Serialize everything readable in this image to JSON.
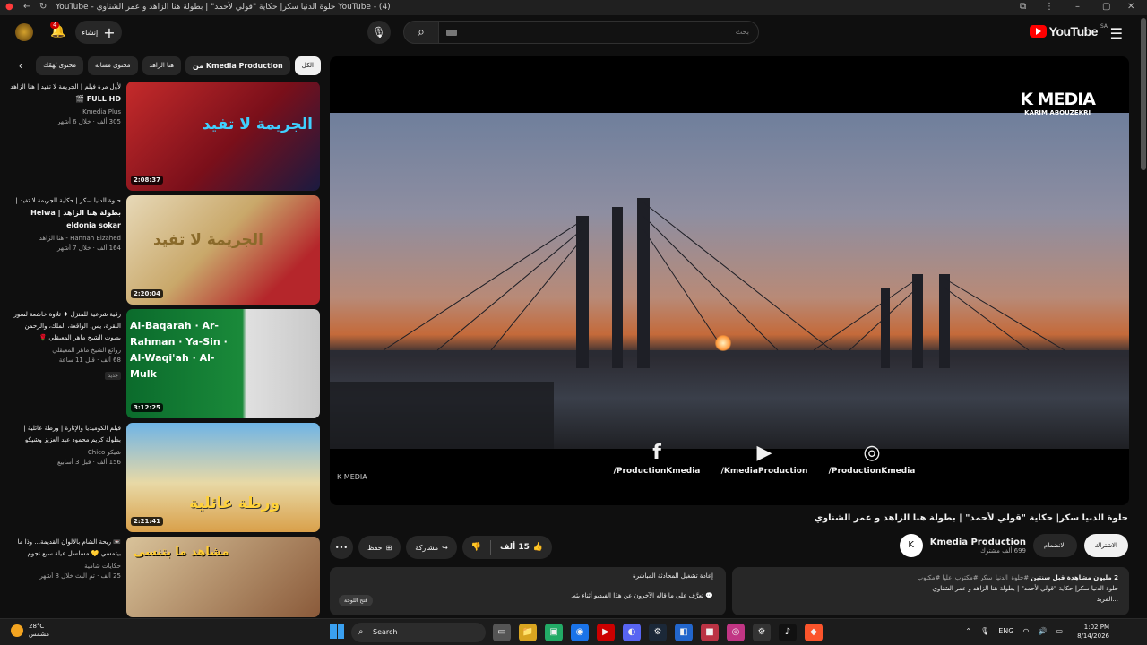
{
  "window": {
    "title": "YouTube - (4) حلوة الدنيا سكر| حكاية \"قولي لأحمد\" | بطولة هنا الزاهد و عمر الشناوي - YouTube"
  },
  "header": {
    "logo_text": "YouTube",
    "region": "SA",
    "search_placeholder": "بحث",
    "create_label": "إنشاء",
    "notifications_count": "4"
  },
  "chips": [
    {
      "label": "الكل",
      "active": true
    },
    {
      "label": "من Kmedia Production",
      "active": false,
      "bold": true
    },
    {
      "label": "هنا الزاهد",
      "active": false
    },
    {
      "label": "محتوى مشابه",
      "active": false
    },
    {
      "label": "محتوى يُهمّك",
      "active": false
    }
  ],
  "recommendations": [
    {
      "title": "لأول مرة فيلم | الجريمة لا تفيد | هنا الزاهد",
      "title2": "FULL HD 🎬",
      "channel": "Kmedia Plus",
      "stats": "305 ألف · خلال 6 أشهر",
      "duration": "2:08:37",
      "thumb_text": "الجريمة لا تفيد",
      "new": ""
    },
    {
      "title": "حلوة الدنيا سكر | حكاية الجريمة لا تفيد |",
      "title2": "بطولة هنا الزاهد | Helwa eldonia sokar",
      "channel": "Hannah Elzahed - هنا الزاهد",
      "stats": "164 ألف · خلال 7 أشهر",
      "duration": "2:20:04",
      "thumb_text": "الجريمة لا تفيد",
      "new": ""
    },
    {
      "title": "رقية شرعية للمنزل ♦ تلاوة خاشعة لسور البقرة، يس، الواقعة، الملك، والرحمن",
      "title2": "بصوت الشيخ ماهر المعيقلي 🌹",
      "channel": "روائع الشيخ ماهر المعيقلي",
      "stats": "68 ألف · قبل 11 ساعة",
      "duration": "3:12:25",
      "thumb_text": "Al-Baqarah · Ar-Rahman · Ya-Sin · Al-Waqi'ah · Al-Mulk",
      "new": "جديد"
    },
    {
      "title": "فيلم الكوميديا والإثارة | ورطة عائلية |",
      "title2": "بطولة كريم محمود عبد العزيز وشيكو",
      "channel": "شيكو Chico",
      "stats": "156 ألف · قبل 3 أسابيع",
      "duration": "2:21:41",
      "thumb_text": "ورطة عائلية",
      "new": ""
    },
    {
      "title": "📼 ريحة الشام بالألوان القديمة... وذا ما",
      "title2": "بيتمسي 💛 مسلسل عيلة سبع نجوم",
      "channel": "حكايات شامية",
      "stats": "25 ألف · تم البث خلال 8 أشهر",
      "duration": "",
      "thumb_text": "مشاهد ما بتنسى",
      "new": ""
    }
  ],
  "player": {
    "brand_big": "K MEDIA",
    "brand_small": "KARIM ABOUZEKRI",
    "socials": [
      {
        "icon": "f",
        "label": "/ProductionKmedia"
      },
      {
        "icon": "▶",
        "label": "/KmediaProduction"
      },
      {
        "icon": "◎",
        "label": "/ProductionKmedia"
      }
    ],
    "mini_logo": "K MEDIA"
  },
  "video": {
    "title": "حلوة الدنيا سكر| حكاية \"قولي لأحمد\" | بطولة هنا الزاهد و عمر الشناوي",
    "channel": "Kmedia Production",
    "subscribers": "699 ألف مشترك",
    "subscribe_label": "الاشتراك",
    "join_label": "الانضمام",
    "likes": "15 ألف",
    "share_label": "مشاركة",
    "save_label": "حفظ"
  },
  "description": {
    "stats": "2 مليون مشاهدة  قبل سنتين",
    "tags": "#حلوة_الدنيا_سكر #مكتوب_عليا #مكتوب",
    "text": "حلوة الدنيا سكر| حكاية \"قولي لأحمد\" | بطولة هنا الزاهد و عمر الشناوي",
    "more": "...المزيد"
  },
  "chat": {
    "header": "إعادة تشغيل المحادثة المباشرة",
    "message": "تعرَّف على ما قاله الآخرون عن هذا الفيديو أثناء بثه.",
    "open_label": "فتح اللوحة"
  },
  "taskbar": {
    "temp": "28°C",
    "weather": "مشمس",
    "search_label": "Search",
    "lang": "ENG",
    "time": "1:02 PM",
    "date": "8/14/2026"
  }
}
